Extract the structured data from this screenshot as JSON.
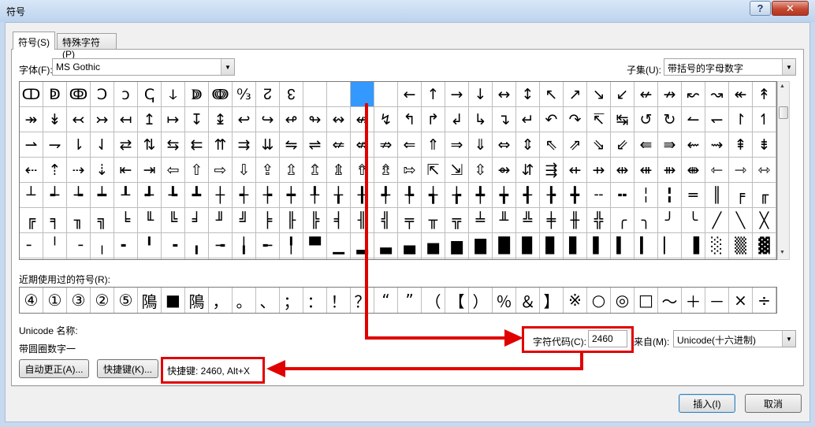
{
  "window": {
    "title": "符号"
  },
  "tabs": {
    "symbols": "符号(S)",
    "special": "特殊字符(P)"
  },
  "font": {
    "label": "字体(F):",
    "value": "MS Gothic"
  },
  "subset": {
    "label": "子集(U):",
    "value": "带括号的字母数字"
  },
  "grid": {
    "selected_index": 14,
    "cells": [
      "ↀ",
      "ↁ",
      "ↂ",
      "Ↄ",
      "ↄ",
      "ↅ",
      "ↆ",
      "ↇ",
      "ↈ",
      "↉",
      "↊",
      "↋",
      "↌",
      "↍",
      "↎",
      "↏",
      "←",
      "↑",
      "→",
      "↓",
      "↔",
      "↕",
      "↖",
      "↗",
      "↘",
      "↙",
      "↚",
      "↛",
      "↜",
      "↝",
      "↞",
      "↟",
      "↠",
      "↡",
      "↢",
      "↣",
      "↤",
      "↥",
      "↦",
      "↧",
      "↨",
      "↩",
      "↪",
      "↫",
      "↬",
      "↭",
      "↮",
      "↯",
      "↰",
      "↱",
      "↲",
      "↳",
      "↴",
      "↵",
      "↶",
      "↷",
      "↸",
      "↹",
      "↺",
      "↻",
      "↼",
      "↽",
      "↾",
      "↿",
      "⇀",
      "⇁",
      "⇂",
      "⇃",
      "⇄",
      "⇅",
      "⇆",
      "⇇",
      "⇈",
      "⇉",
      "⇊",
      "⇋",
      "⇌",
      "⇍",
      "⇎",
      "⇏",
      "⇐",
      "⇑",
      "⇒",
      "⇓",
      "⇔",
      "⇕",
      "⇖",
      "⇗",
      "⇘",
      "⇙",
      "⇚",
      "⇛",
      "⇜",
      "⇝",
      "⇞",
      "⇟",
      "⇠",
      "⇡",
      "⇢",
      "⇣",
      "⇤",
      "⇥",
      "⇦",
      "⇧",
      "⇨",
      "⇩",
      "⇪",
      "⇫",
      "⇬",
      "⇭",
      "⇮",
      "⇯",
      "⇰",
      "⇱",
      "⇲",
      "⇳",
      "⇴",
      "⇵",
      "⇶",
      "⇷",
      "⇸",
      "⇹",
      "⇺",
      "⇻",
      "⇼",
      "⇽",
      "⇾",
      "⇿",
      "┴",
      "┵",
      "┶",
      "┷",
      "┸",
      "┹",
      "┺",
      "┻",
      "┼",
      "┽",
      "┾",
      "┿",
      "╀",
      "╁",
      "╂",
      "╃",
      "╄",
      "╅",
      "╆",
      "╇",
      "╈",
      "╉",
      "╊",
      "╋",
      "╌",
      "╍",
      "╎",
      "╏",
      "═",
      "║",
      "╒",
      "╓",
      "╔",
      "╕",
      "╖",
      "╗",
      "╘",
      "╙",
      "╚",
      "╛",
      "╜",
      "╝",
      "╞",
      "╟",
      "╠",
      "╡",
      "╢",
      "╣",
      "╤",
      "╥",
      "╦",
      "╧",
      "╨",
      "╩",
      "╪",
      "╫",
      "╬",
      "╭",
      "╮",
      "╯",
      "╰",
      "╱",
      "╲",
      "╳",
      "╴",
      "╵",
      "╶",
      "╷",
      "╸",
      "╹",
      "╺",
      "╻",
      "╼",
      "╽",
      "╾",
      "╿",
      "▀",
      "▁",
      "▂",
      "▃",
      "▄",
      "▅",
      "▆",
      "▇",
      "█",
      "▉",
      "▊",
      "▋",
      "▌",
      "▍",
      "▎",
      "▏",
      "▐",
      "░",
      "▒",
      "▓",
      "▔",
      "▕",
      "▖",
      "▗",
      "▘",
      "▙",
      "▚",
      "▛",
      "▜",
      "▝",
      "▞",
      "▟",
      "■",
      "□",
      "▢",
      "▣",
      "▤",
      "▥",
      "▦",
      "▧",
      "▨",
      "▩",
      "▪",
      "▫",
      "▬",
      "▭",
      "▮",
      "▯",
      "▰",
      "▱",
      "▲",
      "△"
    ]
  },
  "recent": {
    "label": "近期使用过的符号(R):",
    "cells": [
      "④",
      "①",
      "③",
      "②",
      "⑤",
      "隝",
      "■",
      "隝",
      "，",
      "。",
      "、",
      "；",
      "：",
      "！",
      "？",
      "“",
      "”",
      "（",
      "【",
      "）",
      "％",
      "＆",
      "】",
      "※",
      "○",
      "◎",
      "□",
      "～",
      "＋",
      "－",
      "×",
      "÷"
    ]
  },
  "unicode": {
    "name_label": "Unicode 名称:",
    "name_value": "带圆圈数字一"
  },
  "charcode": {
    "label": "字符代码(C):",
    "value": "2460"
  },
  "from": {
    "label": "来自(M):",
    "value": "Unicode(十六进制)"
  },
  "buttons": {
    "autocorrect": "自动更正(A)...",
    "shortcut": "快捷键(K)...",
    "insert": "插入(I)",
    "cancel": "取消"
  },
  "shortcut_text": "快捷键: 2460, Alt+X",
  "colors": {
    "accent": "#e00000",
    "selection": "#3399ff"
  }
}
